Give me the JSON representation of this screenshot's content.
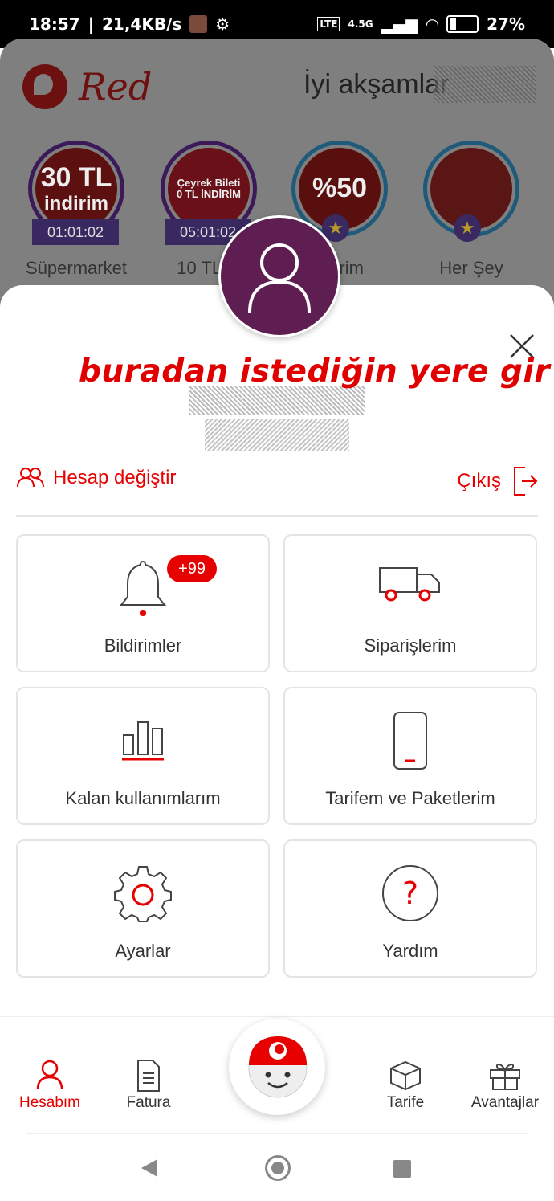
{
  "status_bar": {
    "time": "18:57",
    "speed": "21,4KB/s",
    "network": "4.5G",
    "battery": "27%"
  },
  "header": {
    "brand": "Red",
    "greeting": "İyi akşamlar"
  },
  "stories": [
    {
      "text_top": "30 TL",
      "text_bottom": "indirim",
      "timer": "01:01:02",
      "label": "Süpermarket"
    },
    {
      "text_top": "Çeyrek Bileti",
      "text_bottom": "0 TL İNDİRİM",
      "timer": "05:01:02",
      "label": "10 TL İn"
    },
    {
      "text_top": "%50",
      "text_bottom": "",
      "timer": "",
      "label": "ndirim"
    },
    {
      "text_top": "",
      "text_bottom": "",
      "timer": "",
      "label": "Her Şey"
    }
  ],
  "sheet": {
    "note": "buradan istediğin yere gir",
    "switch_account": "Hesap değiştir",
    "logout": "Çıkış"
  },
  "cards": [
    {
      "label": "Bildirimler",
      "badge": "+99",
      "icon": "bell-icon"
    },
    {
      "label": "Siparişlerim",
      "icon": "truck-icon"
    },
    {
      "label": "Kalan kullanımlarım",
      "icon": "bar-chart-icon"
    },
    {
      "label": "Tarifem ve Paketlerim",
      "icon": "phone-icon"
    },
    {
      "label": "Ayarlar",
      "icon": "gear-icon"
    },
    {
      "label": "Yardım",
      "icon": "help-icon"
    }
  ],
  "bottom_nav": [
    {
      "label": "Hesabım",
      "icon": "user-icon",
      "active": true
    },
    {
      "label": "Fatura",
      "icon": "invoice-icon"
    },
    {
      "label": "Tarife",
      "icon": "box-icon"
    },
    {
      "label": "Avantajlar",
      "icon": "gift-icon"
    }
  ],
  "colors": {
    "accent": "#e60000",
    "avatar_bg": "#5e1e52",
    "dim_bg": "#7f7f7f"
  }
}
